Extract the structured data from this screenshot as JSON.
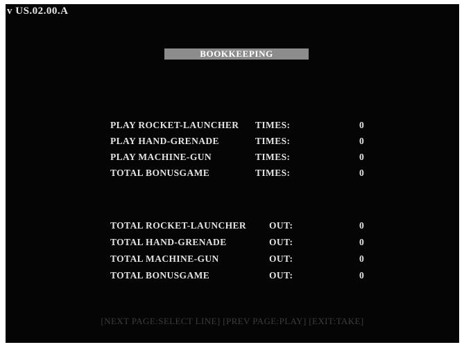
{
  "version": "v US.02.00.A",
  "title": "BOOKKEEPING",
  "play_stats": [
    {
      "label": "PLAY  ROCKET-LAUNCHER",
      "unit": "TIMES:",
      "value": "0"
    },
    {
      "label": "PLAY  HAND-GRENADE",
      "unit": "TIMES:",
      "value": "0"
    },
    {
      "label": "PLAY  MACHINE-GUN",
      "unit": "TIMES:",
      "value": "0"
    },
    {
      "label": "TOTAL  BONUSGAME",
      "unit": "TIMES:",
      "value": "0"
    }
  ],
  "out_stats": [
    {
      "label": "TOTAL  ROCKET-LAUNCHER",
      "unit": "OUT:",
      "value": "0"
    },
    {
      "label": "TOTAL  HAND-GRENADE",
      "unit": "OUT:",
      "value": "0"
    },
    {
      "label": "TOTAL  MACHINE-GUN",
      "unit": "OUT:",
      "value": "0"
    },
    {
      "label": "TOTAL  BONUSGAME",
      "unit": "OUT:",
      "value": "0"
    }
  ],
  "footer": "[NEXT PAGE:SELECT LINE] [PREV PAGE:PLAY] [EXIT:TAKE]",
  "colors": {
    "background": "#050505",
    "text": "#e3e3e3",
    "title_bar": "#8c8c8c",
    "footer_text": "#3c3c3c"
  }
}
